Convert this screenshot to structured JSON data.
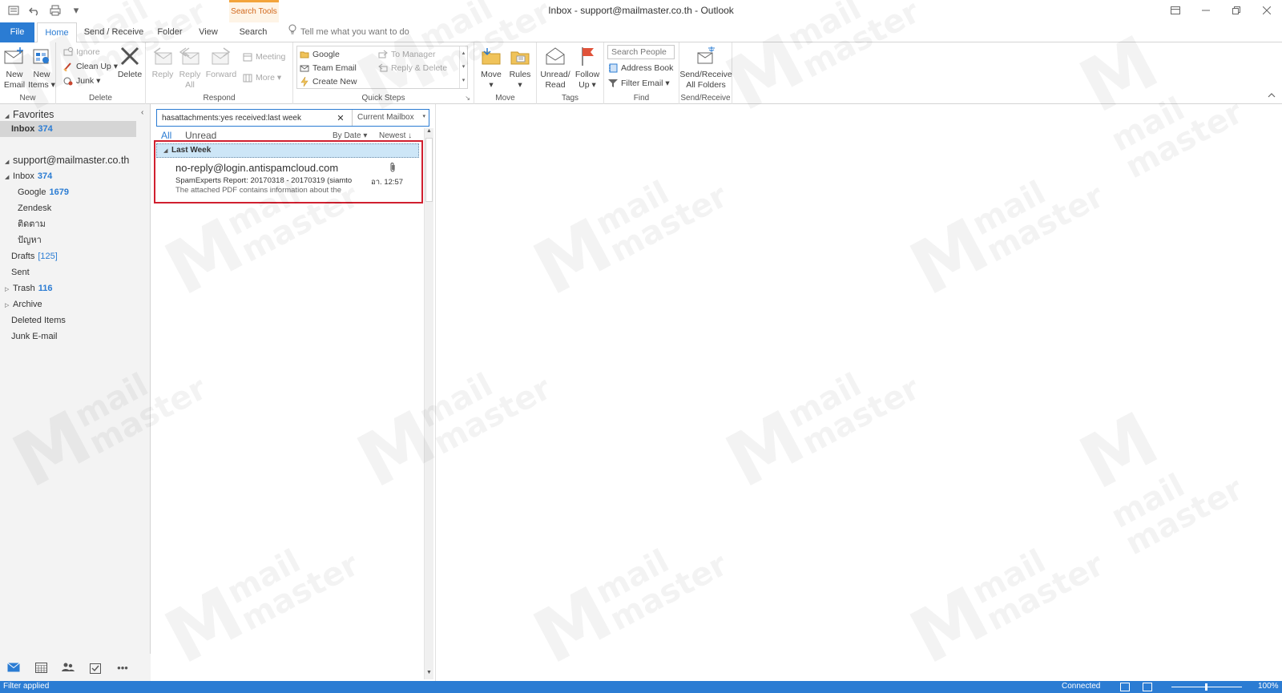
{
  "window": {
    "title": "Inbox - support@mailmaster.co.th  -  Outlook",
    "contextual_tab": "Search Tools"
  },
  "ribbon_tabs": [
    "File",
    "Home",
    "Send / Receive",
    "Folder",
    "View",
    "Search"
  ],
  "tell_me": "Tell me what you want to do",
  "ribbon": {
    "new": {
      "group": "New",
      "new_email": [
        "New",
        "Email"
      ],
      "new_items": [
        "New",
        "Items"
      ]
    },
    "delete": {
      "group": "Delete",
      "ignore": "Ignore",
      "clean_up": "Clean Up",
      "junk": "Junk",
      "delete": "Delete"
    },
    "respond": {
      "group": "Respond",
      "reply": "Reply",
      "reply_all": [
        "Reply",
        "All"
      ],
      "forward": "Forward",
      "meeting": "Meeting",
      "more": "More"
    },
    "quick_steps": {
      "group": "Quick Steps",
      "google": "Google",
      "team_email": "Team Email",
      "create_new": "Create New",
      "to_manager": "To Manager",
      "reply_delete": "Reply & Delete"
    },
    "move": {
      "group": "Move",
      "move": "Move",
      "rules": "Rules"
    },
    "tags": {
      "group": "Tags",
      "unread_read": [
        "Unread/",
        "Read"
      ],
      "follow_up": [
        "Follow",
        "Up"
      ]
    },
    "find": {
      "group": "Find",
      "search_people": "Search People",
      "address_book": "Address Book",
      "filter_email": "Filter Email"
    },
    "send_receive": {
      "group": "Send/Receive",
      "all_folders": [
        "Send/Receive",
        "All Folders"
      ]
    }
  },
  "folders": {
    "favorites_label": "Favorites",
    "fav_inbox": {
      "name": "Inbox",
      "count": "374"
    },
    "account": "support@mailmaster.co.th",
    "inbox": {
      "name": "Inbox",
      "count": "374"
    },
    "google": {
      "name": "Google",
      "count": "1679"
    },
    "zendesk": "Zendesk",
    "thai1": "ติดตาม",
    "thai2": "ปัญหา",
    "drafts": {
      "name": "Drafts",
      "count": "[125]"
    },
    "sent": "Sent",
    "trash": {
      "name": "Trash",
      "count": "116"
    },
    "archive": "Archive",
    "deleted": "Deleted Items",
    "junk": "Junk E-mail"
  },
  "search": {
    "query": "hasattachments:yes received:last week",
    "scope": "Current Mailbox"
  },
  "list_filters": {
    "all": "All",
    "unread": "Unread",
    "sort": "By Date",
    "order": "Newest"
  },
  "group_header": "Last Week",
  "message": {
    "sender": "no-reply@login.antispamcloud.com",
    "subject": "SpamExperts Report: 20170318 - 20170319 (siamto...",
    "date": "อา. 12:57",
    "preview": "The attached PDF contains information about the",
    "has_attachment": true
  },
  "status": {
    "left": "Filter applied",
    "connection": "Connected",
    "zoom": "100%"
  },
  "watermark": {
    "line1": "mail",
    "line2": "master"
  },
  "colors": {
    "accent": "#2b7cd3",
    "highlight_border": "#d01f2f",
    "contextual_tab": "#d2691e",
    "flag": "#e0533b",
    "folder_yellow": "#f0c35a"
  }
}
